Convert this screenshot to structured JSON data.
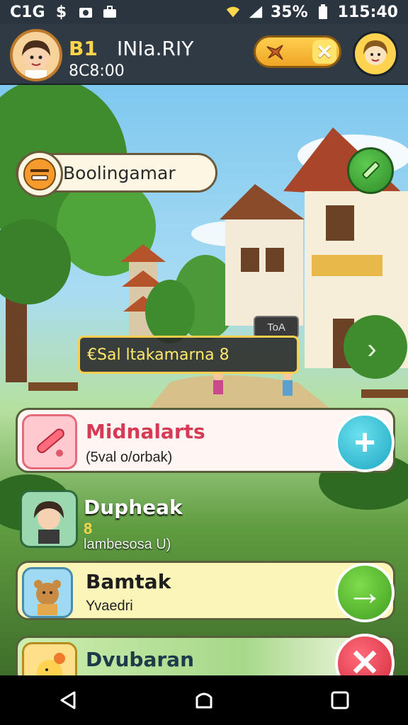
{
  "status_bar": {
    "time_left": "C1G",
    "battery": "35%",
    "clock": "115:40"
  },
  "hud": {
    "level": "B1",
    "player_name": "INIa.RIY",
    "coins": "8C8:00"
  },
  "quest": {
    "label": "Boolingamar"
  },
  "tooltip": {
    "text": "€Sal ltakamarna 8",
    "tag": "ToA"
  },
  "cards": [
    {
      "title": "Midnalarts",
      "subtitle": "(5val o/orbak)"
    },
    {
      "title": "Dupheak",
      "level": "8",
      "subtitle": "lambesosa U)"
    },
    {
      "title": "Bamtak",
      "subtitle": "Yvaedri"
    },
    {
      "title": "Dvubaran"
    }
  ],
  "colors": {
    "hud_bg": "#2f3a44",
    "accent_gold": "#ffcf4d",
    "card_pink_title": "#d63a55",
    "action_cyan": "#1ea8c2",
    "action_green": "#3f9e20",
    "action_red": "#d42b3c"
  },
  "icons": {
    "status_left": [
      "dollar-icon",
      "camera-icon",
      "briefcase-icon"
    ],
    "status_right": [
      "wifi-icon",
      "signal-icon",
      "battery-icon"
    ],
    "nav": [
      "back-icon",
      "home-icon",
      "recents-icon"
    ]
  }
}
